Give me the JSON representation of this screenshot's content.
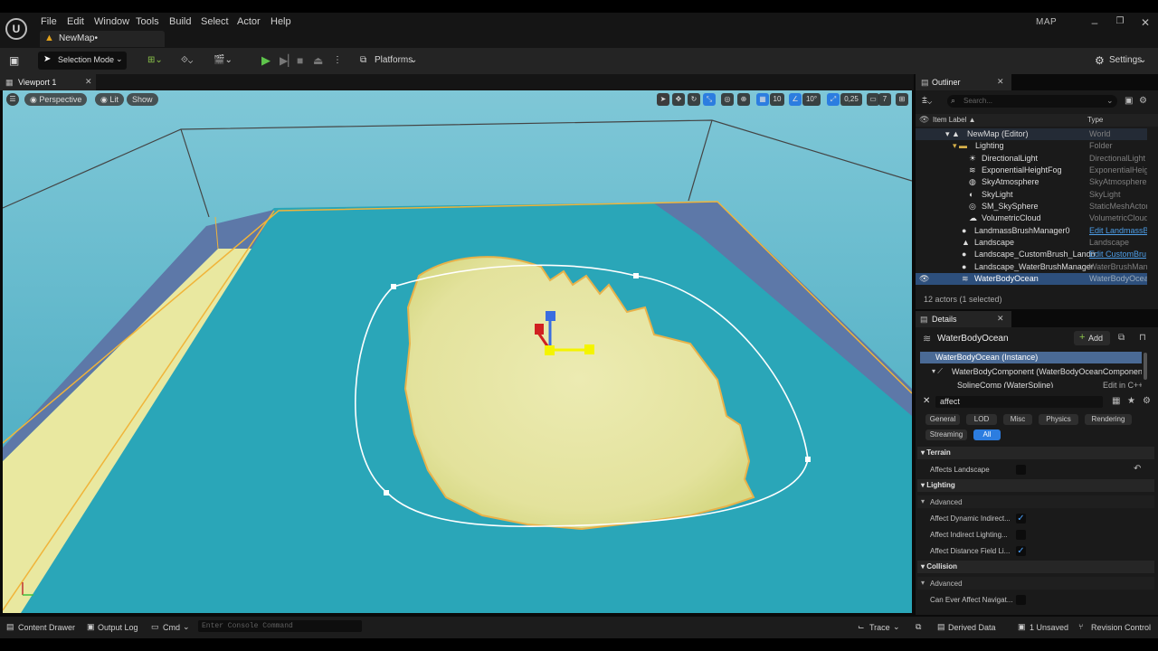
{
  "menu": [
    "File",
    "Edit",
    "Window",
    "Tools",
    "Build",
    "Select",
    "Actor",
    "Help"
  ],
  "map_tab": "NewMap•",
  "map_label": "MAP",
  "toolbar": {
    "selection_mode": "Selection Mode",
    "platforms": "Platforms",
    "settings": "Settings"
  },
  "viewport": {
    "tab": "Viewport 1",
    "perspective": "Perspective",
    "lit": "Lit",
    "show": "Show",
    "grid_snap": "10",
    "rot_snap": "10°",
    "scale_snap": "0,25",
    "cam_speed": "7"
  },
  "outliner": {
    "tab": "Outliner",
    "search_placeholder": "Search...",
    "col_label": "Item Label ▲",
    "col_type": "Type",
    "rows": [
      {
        "name": "NewMap (Editor)",
        "type": "World"
      },
      {
        "name": "Lighting",
        "type": "Folder"
      },
      {
        "name": "DirectionalLight",
        "type": "DirectionalLight"
      },
      {
        "name": "ExponentialHeightFog",
        "type": "ExponentialHeig"
      },
      {
        "name": "SkyAtmosphere",
        "type": "SkyAtmosphere"
      },
      {
        "name": "SkyLight",
        "type": "SkyLight"
      },
      {
        "name": "SM_SkySphere",
        "type": "StaticMeshActor"
      },
      {
        "name": "VolumetricCloud",
        "type": "VolumetricCloud"
      },
      {
        "name": "LandmassBrushManager0",
        "type": "Edit LandmassB"
      },
      {
        "name": "Landscape",
        "type": "Landscape"
      },
      {
        "name": "Landscape_CustomBrush_Landma",
        "type": "Edit CustomBru"
      },
      {
        "name": "Landscape_WaterBrushManager",
        "type": "WaterBrushMan"
      },
      {
        "name": "WaterBodyOcean",
        "type": "WaterBodyOcea"
      }
    ],
    "status": "12 actors (1 selected)"
  },
  "details": {
    "tab": "Details",
    "actor": "WaterBodyOcean",
    "add": "Add",
    "comp_instance": "WaterBodyOcean (Instance)",
    "comp_water": "WaterBodyComponent (WaterBodyOceanComponent)",
    "comp_spline": "SplineComp (WaterSpline)",
    "comp_spline_edit": "Edit in C++",
    "filter": "affect",
    "categories": [
      "General",
      "LOD",
      "Misc",
      "Physics",
      "Rendering",
      "Streaming",
      "All"
    ],
    "sections": {
      "terrain": "Terrain",
      "affects_landscape": "Affects Landscape",
      "lighting": "Lighting",
      "advanced": "Advanced",
      "affect_dynamic": "Affect Dynamic Indirect...",
      "affect_indirect": "Affect Indirect Lighting...",
      "affect_distance": "Affect Distance Field Li...",
      "collision": "Collision",
      "advanced2": "Advanced",
      "can_ever": "Can Ever Affect Navigat..."
    },
    "checks": {
      "affects_landscape": false,
      "affect_dynamic": true,
      "affect_indirect": false,
      "affect_distance": true,
      "can_ever": false
    }
  },
  "statusbar": {
    "content_drawer": "Content Drawer",
    "output_log": "Output Log",
    "cmd": "Cmd",
    "console_placeholder": "Enter Console Command",
    "trace": "Trace",
    "derived_data": "Derived Data",
    "unsaved": "1 Unsaved",
    "revision": "Revision Control"
  },
  "colors": {
    "water": "#2aa3b5",
    "island": "#e8e6a8",
    "selection": "#f0b43a",
    "bg": "#1a1a1a"
  }
}
